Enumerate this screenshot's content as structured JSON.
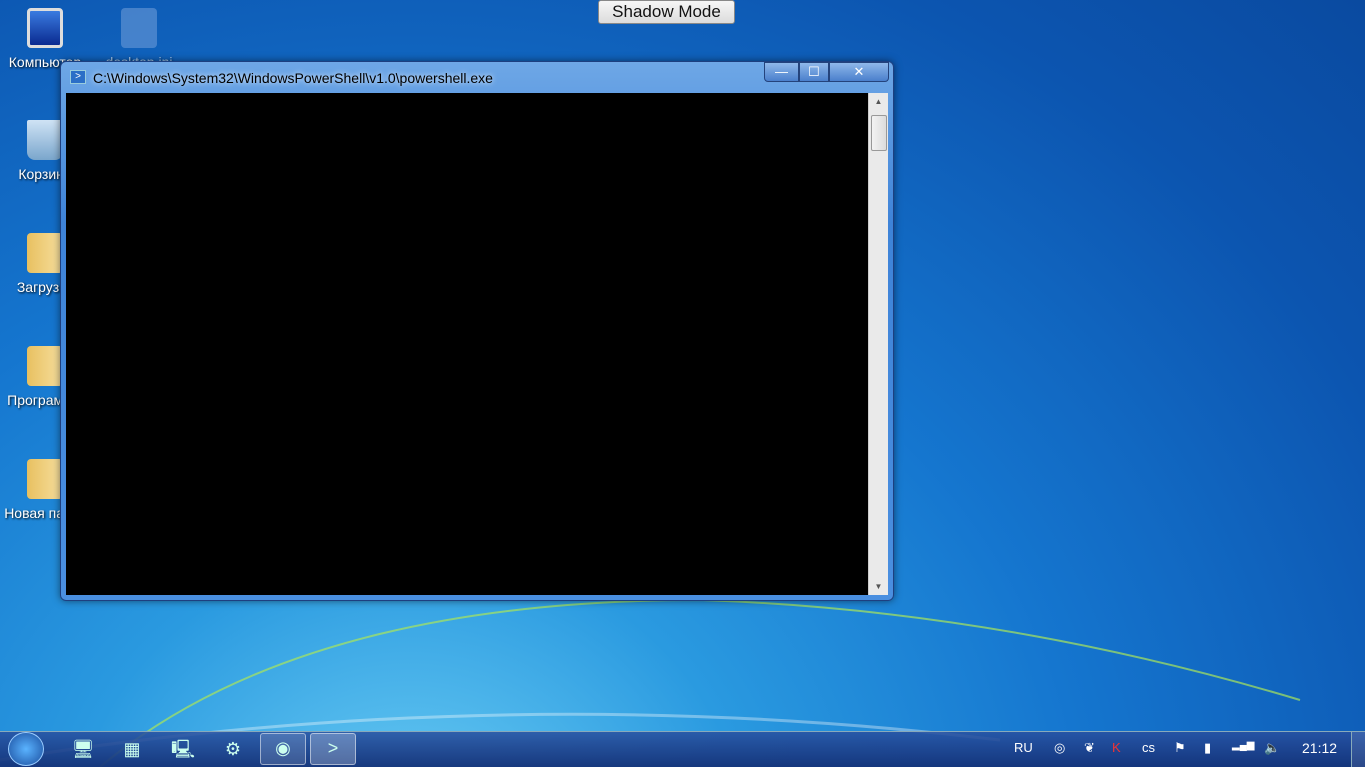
{
  "desktop": {
    "icons": [
      {
        "label": "Компьютер",
        "icon": "computer-icon"
      },
      {
        "label": "desktop.ini",
        "icon": "settings-file-icon"
      },
      {
        "label": "Корзина",
        "icon": "recycle-bin-icon"
      },
      {
        "label": "Загрузки",
        "icon": "folder-icon"
      },
      {
        "label": "Программы",
        "icon": "folder-icon"
      },
      {
        "label": "Новая папка",
        "icon": "folder-icon"
      }
    ]
  },
  "shadow_mode": "Shadow Mode",
  "window": {
    "title": "C:\\Windows\\System32\\WindowsPowerShell\\v1.0\\powershell.exe",
    "minimize": "—",
    "maximize": "☐",
    "close": "✕"
  },
  "taskbar": {
    "language": "RU",
    "clock": "21:12"
  }
}
